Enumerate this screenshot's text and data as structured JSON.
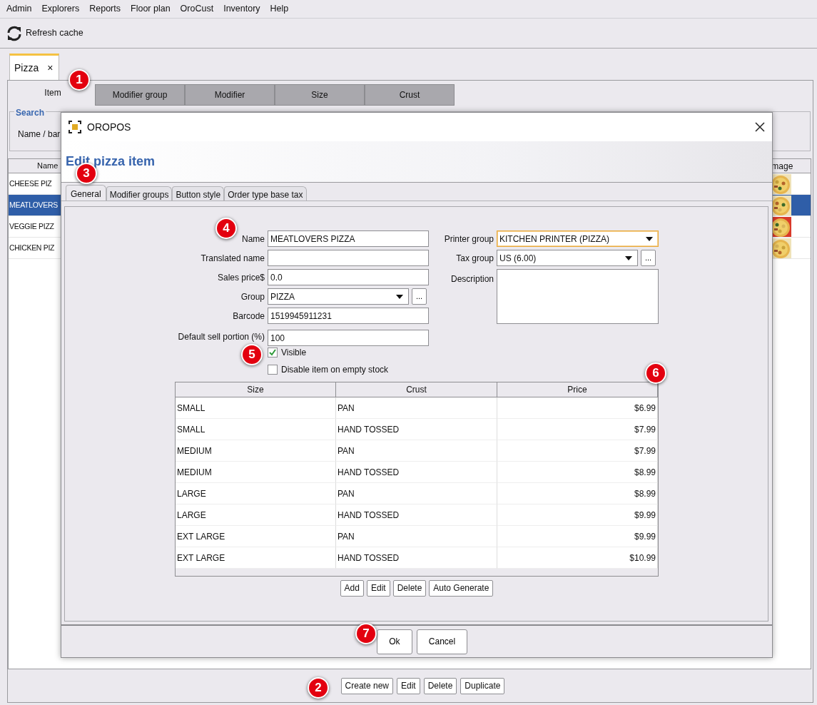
{
  "menu": [
    "Admin",
    "Explorers",
    "Reports",
    "Floor plan",
    "OroCust",
    "Inventory",
    "Help"
  ],
  "toolbar": [
    {
      "label": "Refresh cache"
    }
  ],
  "document_tabs": [
    {
      "label": "Pizza",
      "close": "×",
      "selected": true
    }
  ],
  "section_tabs": [
    {
      "label": "Item",
      "selected": true
    },
    {
      "label": "Modifier group",
      "selected": false
    },
    {
      "label": "Modifier",
      "selected": false
    },
    {
      "label": "Size",
      "selected": false
    },
    {
      "label": "Crust",
      "selected": false
    }
  ],
  "search": {
    "title": "Search",
    "label": "Name / bar"
  },
  "items_table": {
    "columns": [
      "Name",
      "mage"
    ],
    "rows": [
      {
        "name": "CHEESE PIZ",
        "selected": false
      },
      {
        "name": "MEATLOVERS",
        "selected": true
      },
      {
        "name": "VEGGIE PIZZ",
        "selected": false
      },
      {
        "name": "CHICKEN PIZ",
        "selected": false
      }
    ]
  },
  "bottom_buttons": [
    "Create new",
    "Edit",
    "Delete",
    "Duplicate"
  ],
  "dialog": {
    "title": "OROPOS",
    "heading": "Edit pizza item",
    "tabs": [
      {
        "label": "General",
        "selected": true
      },
      {
        "label": "Modifier groups",
        "selected": false
      },
      {
        "label": "Button style",
        "selected": false
      },
      {
        "label": "Order type base tax",
        "selected": false
      }
    ],
    "fields_left": [
      {
        "label": "Name",
        "kind": "text",
        "value": "MEATLOVERS PIZZA"
      },
      {
        "label": "Translated name",
        "kind": "text"
      },
      {
        "label": "Sales price$",
        "kind": "text",
        "value": "0.0"
      },
      {
        "label": "Group",
        "kind": "combo",
        "value": "PIZZA",
        "more": "..."
      },
      {
        "label": "Barcode",
        "kind": "text",
        "value": "1519945911231"
      },
      {
        "label": "Default sell portion (%)",
        "kind": "text",
        "value": "100"
      }
    ],
    "fields_right": [
      {
        "label": "Printer group",
        "kind": "combo",
        "value": "KITCHEN PRINTER (PIZZA)",
        "focused": true
      },
      {
        "label": "Tax group",
        "kind": "combo",
        "value": "US (6.00)",
        "more": "...",
        "focused": false
      },
      {
        "label": "Description",
        "kind": "textarea",
        "focused": false
      }
    ],
    "checkboxes": [
      {
        "label": "Visible",
        "checked": true
      },
      {
        "label": "Disable item on empty stock",
        "checked": false
      }
    ],
    "price_table": {
      "columns": [
        "Size",
        "Crust",
        "Price"
      ],
      "rows": [
        {
          "size": "SMALL",
          "crust": "PAN",
          "price": "$6.99"
        },
        {
          "size": "SMALL",
          "crust": "HAND TOSSED",
          "price": "$7.99"
        },
        {
          "size": "MEDIUM",
          "crust": "PAN",
          "price": "$7.99"
        },
        {
          "size": "MEDIUM",
          "crust": "HAND TOSSED",
          "price": "$8.99"
        },
        {
          "size": "LARGE",
          "crust": "PAN",
          "price": "$8.99"
        },
        {
          "size": "LARGE",
          "crust": "HAND TOSSED",
          "price": "$9.99"
        },
        {
          "size": "EXT LARGE",
          "crust": "PAN",
          "price": "$9.99"
        },
        {
          "size": "EXT LARGE",
          "crust": "HAND TOSSED",
          "price": "$10.99"
        }
      ]
    },
    "table_buttons": [
      "Add",
      "Edit",
      "Delete",
      "Auto Generate"
    ],
    "footer_buttons": [
      "Ok",
      "Cancel"
    ]
  },
  "callouts": [
    {
      "label": "1"
    },
    {
      "label": "2"
    },
    {
      "label": "3"
    },
    {
      "label": "4"
    },
    {
      "label": "5"
    },
    {
      "label": "6"
    },
    {
      "label": "7"
    }
  ]
}
